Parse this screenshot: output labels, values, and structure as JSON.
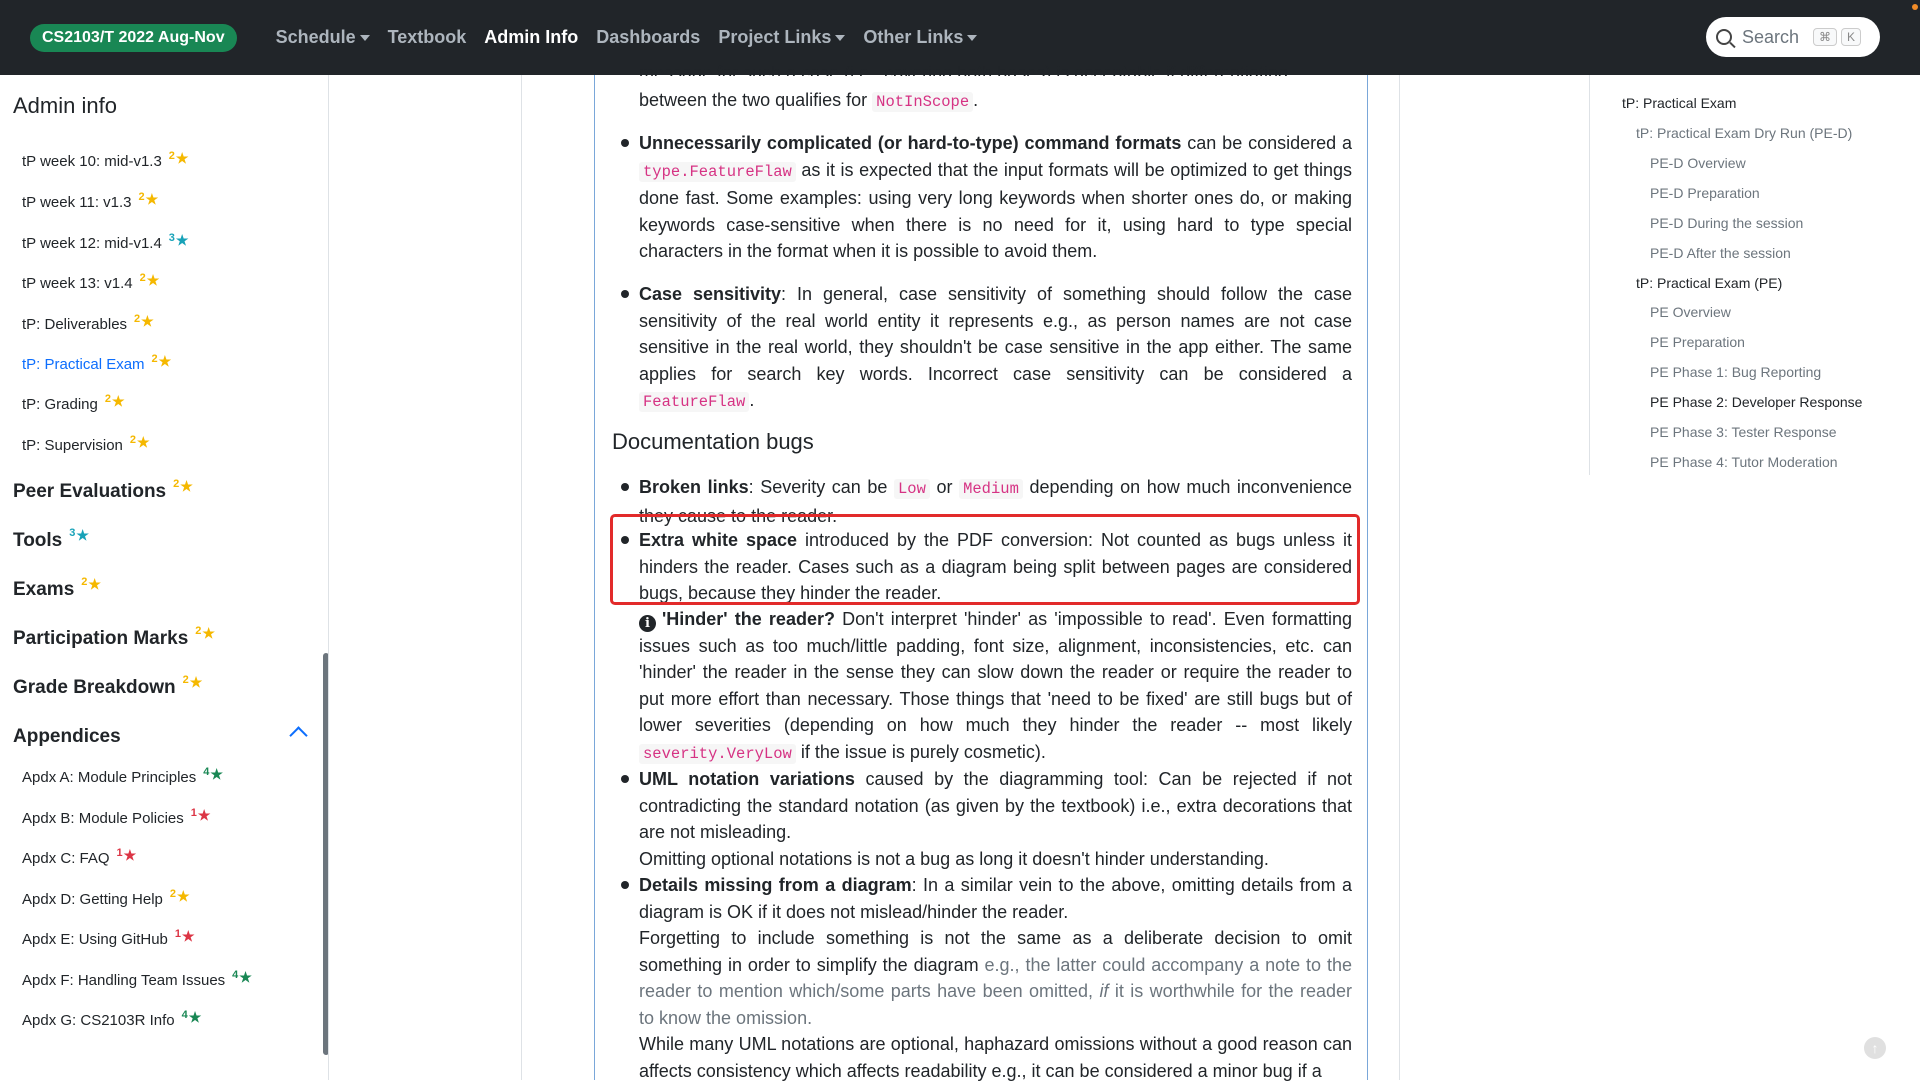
{
  "navbar": {
    "brand": "CS2103/T 2022 Aug-Nov",
    "items": [
      {
        "label": "Schedule",
        "dropdown": true,
        "active": false
      },
      {
        "label": "Textbook",
        "dropdown": false,
        "active": false
      },
      {
        "label": "Admin Info",
        "dropdown": false,
        "active": true
      },
      {
        "label": "Dashboards",
        "dropdown": false,
        "active": false
      },
      {
        "label": "Project Links",
        "dropdown": true,
        "active": false
      },
      {
        "label": "Other Links",
        "dropdown": true,
        "active": false
      }
    ],
    "search": {
      "label": "Search",
      "key1": "⌘",
      "key2": "K"
    }
  },
  "sidebar": {
    "title": "Admin info",
    "items": [
      {
        "label": "tP week 10: mid-v1.3",
        "badge": "2",
        "color": "yellow"
      },
      {
        "label": "tP week 11: v1.3",
        "badge": "2",
        "color": "yellow"
      },
      {
        "label": "tP week 12: mid-v1.4",
        "badge": "3",
        "color": "teal"
      },
      {
        "label": "tP week 13: v1.4",
        "badge": "2",
        "color": "yellow"
      },
      {
        "label": "tP: Deliverables",
        "badge": "2",
        "color": "yellow"
      },
      {
        "label": "tP: Practical Exam",
        "badge": "2",
        "color": "yellow",
        "current": true
      },
      {
        "label": "tP: Grading",
        "badge": "2",
        "color": "yellow"
      },
      {
        "label": "tP: Supervision",
        "badge": "2",
        "color": "yellow"
      }
    ],
    "sections": [
      {
        "label": "Peer Evaluations",
        "badge": "2",
        "color": "yellow"
      },
      {
        "label": "Tools",
        "badge": "3",
        "color": "teal"
      },
      {
        "label": "Exams",
        "badge": "2",
        "color": "yellow"
      },
      {
        "label": "Participation Marks",
        "badge": "2",
        "color": "yellow"
      },
      {
        "label": "Grade Breakdown",
        "badge": "2",
        "color": "yellow"
      },
      {
        "label": "Appendices",
        "badge": "",
        "color": ""
      }
    ],
    "appendices": [
      {
        "label": "Apdx A: Module Principles",
        "badge": "4",
        "color": "green"
      },
      {
        "label": "Apdx B: Module Policies",
        "badge": "1",
        "color": "red"
      },
      {
        "label": "Apdx C: FAQ",
        "badge": "1",
        "color": "red"
      },
      {
        "label": "Apdx D: Getting Help",
        "badge": "2",
        "color": "yellow"
      },
      {
        "label": "Apdx E: Using GitHub",
        "badge": "1",
        "color": "red"
      },
      {
        "label": "Apdx F: Handling Team Issues",
        "badge": "4",
        "color": "green"
      },
      {
        "label": "Apdx G: CS2103R Info",
        "badge": "4",
        "color": "green"
      }
    ]
  },
  "main": {
    "cut_text": "message for such a case (i.e., covering both bases) is acceptable if differentiating",
    "p1": {
      "text_before": "between the two qualifies for ",
      "code": "NotInScope",
      "text_after": "."
    },
    "p2": {
      "bold": "Unnecessarily complicated (or hard-to-type) command formats",
      "t1": " can be considered a ",
      "code": "type.FeatureFlaw",
      "t2": " as it is expected that the input formats will be optimized to get things done fast. Some examples: using very long keywords when shorter ones do, or making keywords case-sensitive when there is no need for it, using hard to type special characters in the format when it is possible to avoid them."
    },
    "p3": {
      "bold": "Case sensitivity",
      "t1": ": In general, case sensitivity of something should follow the case sensitivity of the real world entity it represents e.g., as person names are not case sensitive in the real world, they shouldn't be case sensitive in the app either. The same applies for search key words. Incorrect case sensitivity can be considered a ",
      "code": "FeatureFlaw",
      "t2": "."
    },
    "doc_heading": "Documentation bugs",
    "p4": {
      "bold": "Broken links",
      "t1": ": Severity can be ",
      "code1": "Low",
      "t2": " or ",
      "code2": "Medium",
      "t3": " depending on how much inconvenience they cause to the reader."
    },
    "p5": {
      "bold": "Extra white space",
      "t1": " introduced by the PDF conversion: Not counted as bugs unless it hinders the reader. Cases such as a diagram being split between pages are considered bugs, because they hinder the reader."
    },
    "p6": {
      "bold": "'Hinder' the reader?",
      "t1": " Don't interpret 'hinder' as 'impossible to read'. Even formatting issues such as too much/little padding, font size, alignment, inconsistencies, etc. can 'hinder' the reader in the sense they can slow down the reader or require the reader to put more effort than necessary. Those things that 'need to be fixed' are still bugs but of lower severities (depending on how much they hinder the reader -- most likely ",
      "code": "severity.VeryLow",
      "t2": " if the issue is purely cosmetic)."
    },
    "p7": {
      "bold": "UML notation variations",
      "t1": " caused by the diagramming tool: Can be rejected if not contradicting the standard notation (as given by the textbook) i.e., extra decorations that are not misleading.",
      "t2": "Omitting optional notations is not a bug as long it doesn't hinder understanding."
    },
    "p8": {
      "bold": "Details missing from a diagram",
      "t1": ": In a similar vein to the above, omitting details from a diagram is OK if it does not mislead/hinder the reader.",
      "t2": "Forgetting to include something is not the same as a deliberate decision to omit something in order to simplify the diagram ",
      "muted1": "e.g., the latter could accompany a note to the reader to mention which/some parts have been omitted, ",
      "muted_italic": "if",
      "muted2": " it is worthwhile for the reader to know the omission.",
      "t3": "While many UML notations are optional, haphazard omissions without a good reason can affects consistency which affects readability e.g., it can be considered a minor bug if a"
    }
  },
  "toc": {
    "items": [
      {
        "label": "tP: Practical Exam",
        "level": 1,
        "dark": true
      },
      {
        "label": "tP: Practical Exam Dry Run (PE-D)",
        "level": 2,
        "dark": false
      },
      {
        "label": "PE-D Overview",
        "level": 3,
        "dark": false
      },
      {
        "label": "PE-D Preparation",
        "level": 3,
        "dark": false
      },
      {
        "label": "PE-D During the session",
        "level": 3,
        "dark": false
      },
      {
        "label": "PE-D After the session",
        "level": 3,
        "dark": false
      },
      {
        "label": "tP: Practical Exam (PE)",
        "level": 2,
        "dark": true
      },
      {
        "label": "PE Overview",
        "level": 3,
        "dark": false
      },
      {
        "label": "PE Preparation",
        "level": 3,
        "dark": false
      },
      {
        "label": "PE Phase 1: Bug Reporting",
        "level": 3,
        "dark": false
      },
      {
        "label": "PE Phase 2: Developer Response",
        "level": 3,
        "dark": true
      },
      {
        "label": "PE Phase 3: Tester Response",
        "level": 3,
        "dark": false
      },
      {
        "label": "PE Phase 4: Tutor Moderation",
        "level": 3,
        "dark": false
      }
    ]
  }
}
